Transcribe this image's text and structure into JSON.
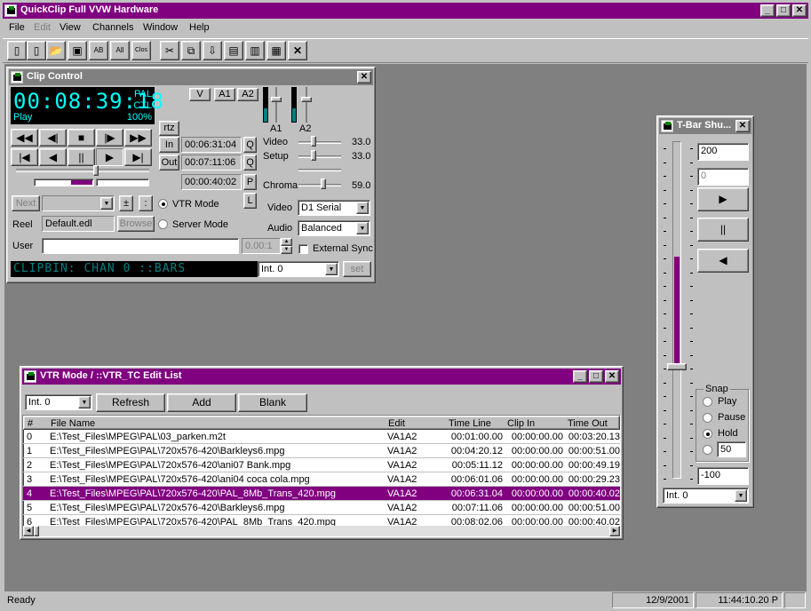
{
  "app": {
    "title": "QuickClip Full VVW Hardware"
  },
  "menu": [
    "File",
    "Edit",
    "View",
    "Channels",
    "Window",
    "Help"
  ],
  "toolbar": {
    "items": [
      "new-icon",
      "new-pl-icon",
      "open-icon",
      "save-icon",
      "ab-icon",
      "all-icon",
      "clos-icon",
      "cut-icon",
      "copy-icon",
      "insert-icon",
      "replace-icon",
      "paste-before-icon",
      "paste-after-icon",
      "delete-icon"
    ]
  },
  "clip_control": {
    "title": "Clip Control",
    "timecode": "00:08:39:18",
    "standard": "PAL",
    "ctl": "CTL",
    "state": "Play",
    "speed": "100%",
    "track_buttons": [
      "V",
      "A1",
      "A2"
    ],
    "audio_labels": [
      "A1",
      "A2"
    ],
    "rtz": "rtz",
    "in_label": "In",
    "out_label": "Out",
    "in_tc": "00:06:31:04",
    "out_tc": "00:07:11:06",
    "dur_tc": "00:00:40:02",
    "q1": "Q",
    "q2": "Q",
    "p": "P",
    "l": "L",
    "video_label": "Video",
    "video_value": "33.0",
    "setup_label": "Setup",
    "setup_value": "33.0",
    "chroma_label": "Chroma",
    "chroma_value": "59.0",
    "next_label": "Next",
    "plus": "±",
    "colon": ":",
    "vtr_mode": "VTR Mode",
    "server_mode": "Server Mode",
    "reel_label": "Reel",
    "reel_value": "Default.edl",
    "browse": "Browse",
    "user_label": "User",
    "user_value": "",
    "spin_value": "0.00:1",
    "video_sel_label": "Video",
    "video_sel_value": "D1 Serial",
    "audio_sel_label": "Audio",
    "audio_sel_value": "Balanced",
    "ext_sync": "External Sync",
    "status_text": "CLIPBIN: CHAN 0 ::BARS",
    "int_value": "Int. 0",
    "set": "set"
  },
  "edit_list": {
    "title": "VTR Mode / ::VTR_TC Edit List",
    "int_value": "Int. 0",
    "refresh": "Refresh",
    "add": "Add",
    "blank": "Blank",
    "columns": [
      "#",
      "File Name",
      "Edit",
      "Time Line",
      "Clip In",
      "Time Out"
    ],
    "rows": [
      [
        "0",
        "E:\\Test_Files\\MPEG\\PAL\\03_parken.m2t",
        "VA1A2",
        "00:01:00.00",
        "00:00:00.00",
        "00:03:20.13"
      ],
      [
        "1",
        "E:\\Test_Files\\MPEG\\PAL\\720x576-420\\Barkleys6.mpg",
        "VA1A2",
        "00:04:20.12",
        "00:00:00.00",
        "00:00:51.00"
      ],
      [
        "2",
        "E:\\Test_Files\\MPEG\\PAL\\720x576-420\\ani07 Bank.mpg",
        "VA1A2",
        "00:05:11.12",
        "00:00:00.00",
        "00:00:49.19"
      ],
      [
        "3",
        "E:\\Test_Files\\MPEG\\PAL\\720x576-420\\ani04 coca cola.mpg",
        "VA1A2",
        "00:06:01.06",
        "00:00:00.00",
        "00:00:29.23"
      ],
      [
        "4",
        "E:\\Test_Files\\MPEG\\PAL\\720x576-420\\PAL_8Mb_Trans_420.mpg",
        "VA1A2",
        "00:06:31.04",
        "00:00:00.00",
        "00:00:40.02"
      ],
      [
        "5",
        "E:\\Test_Files\\MPEG\\PAL\\720x576-420\\Barkleys6.mpg",
        "VA1A2",
        "00:07:11.06",
        "00:00:00.00",
        "00:00:51.00"
      ],
      [
        "6",
        "E:\\Test_Files\\MPEG\\PAL\\720x576-420\\PAL_8Mb_Trans_420.mpg",
        "VA1A2",
        "00:08:02.06",
        "00:00:00.00",
        "00:00:40.02"
      ]
    ],
    "selected_row": 4
  },
  "tbar": {
    "title": "T-Bar Shu...",
    "value_top": "200",
    "value_2": "0",
    "snap_label": "Snap",
    "snap_options": [
      "Play",
      "Pause",
      "Hold",
      ""
    ],
    "snap_selected": 2,
    "snap_value": "50",
    "value_bottom": "-100",
    "int_value": "Int. 0",
    "level": 0.55
  },
  "status": {
    "text": "Ready",
    "date": "12/9/2001",
    "time": "11:44:10.20 P"
  },
  "colors": {
    "title": "#800080",
    "accent": "#800080",
    "desktop": "#808080"
  }
}
